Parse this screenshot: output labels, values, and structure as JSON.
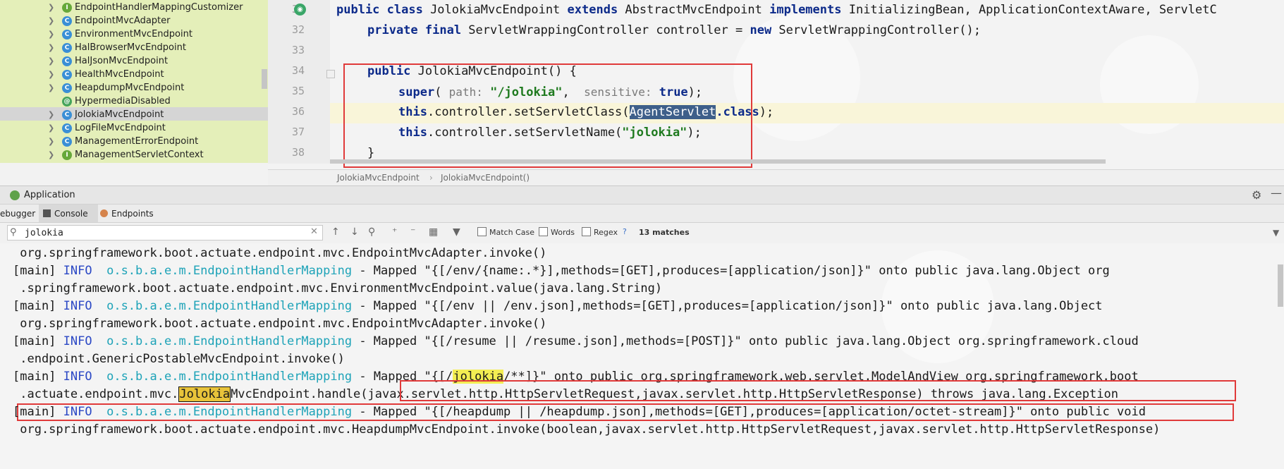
{
  "tree": {
    "items": [
      {
        "label": "EndpointHandlerMappingCustomizer",
        "kind": "interface"
      },
      {
        "label": "EndpointMvcAdapter",
        "kind": "class"
      },
      {
        "label": "EnvironmentMvcEndpoint",
        "kind": "class"
      },
      {
        "label": "HalBrowserMvcEndpoint",
        "kind": "class"
      },
      {
        "label": "HalJsonMvcEndpoint",
        "kind": "class"
      },
      {
        "label": "HealthMvcEndpoint",
        "kind": "class"
      },
      {
        "label": "HeapdumpMvcEndpoint",
        "kind": "class"
      },
      {
        "label": "HypermediaDisabled",
        "kind": "annotation"
      },
      {
        "label": "JolokiaMvcEndpoint",
        "kind": "class",
        "selected": true
      },
      {
        "label": "LogFileMvcEndpoint",
        "kind": "class"
      },
      {
        "label": "ManagementErrorEndpoint",
        "kind": "class"
      },
      {
        "label": "ManagementServletContext",
        "kind": "interface"
      }
    ]
  },
  "editor": {
    "line_numbers": [
      "31",
      "32",
      "33",
      "34",
      "35",
      "36",
      "37",
      "38"
    ],
    "lines": {
      "l31": {
        "kw1": "public class",
        "t1": " JolokiaMvcEndpoint ",
        "kw2": "extends",
        "t2": " AbstractMvcEndpoint ",
        "kw3": "implements",
        "t3": " InitializingBean, ApplicationContextAware, ServletC"
      },
      "l32": {
        "kw1": "private final",
        "t1": " ServletWrappingController controller = ",
        "kw2": "new",
        "t2": " ServletWrappingController();"
      },
      "l34": {
        "kw1": "public",
        "t1": " JolokiaMvcEndpoint() {"
      },
      "l35": {
        "kw1": "super",
        "t1": "( ",
        "hint1": "path:",
        "str1": " \"/jolokia\"",
        "t2": ",  ",
        "hint2": "sensitive:",
        "kw2": " true",
        "t3": ");"
      },
      "l36": {
        "kw1": "this",
        "t1": ".controller.setServletClass(",
        "sel": "AgentServlet",
        "kw2": ".class",
        "t2": ");"
      },
      "l37": {
        "kw1": "this",
        "t1": ".controller.setServletName(",
        "str1": "\"jolokia\"",
        "t2": ");"
      },
      "l38": {
        "t1": "}"
      }
    },
    "breadcrumb": [
      "JolokiaMvcEndpoint",
      "JolokiaMvcEndpoint()"
    ]
  },
  "run": {
    "title": "Application",
    "tabs": [
      "ebugger",
      "Console",
      "Endpoints"
    ]
  },
  "search": {
    "value": "jolokia",
    "options": [
      "Match Case",
      "Words",
      "Regex"
    ],
    "help": "?",
    "matches": "13 matches"
  },
  "console": {
    "prefix": "[main] ",
    "level": "INFO",
    "logger": "o.s.b.a.e.m.EndpointHandlerMapping",
    "lines": [
      {
        "text": " org.springframework.boot.actuate.endpoint.mvc.EndpointMvcAdapter.invoke()"
      },
      {
        "msg": " - Mapped \"{[/env/{name:.*}],methods=[GET],produces=[application/json]}\" onto public java.lang.Object org"
      },
      {
        "text": " .springframework.boot.actuate.endpoint.mvc.EnvironmentMvcEndpoint.value(java.lang.String)"
      },
      {
        "msg": " - Mapped \"{[/env || /env.json],methods=[GET],produces=[application/json]}\" onto public java.lang.Object"
      },
      {
        "text": " org.springframework.boot.actuate.endpoint.mvc.EndpointMvcAdapter.invoke()"
      },
      {
        "msg": " - Mapped \"{[/resume || /resume.json],methods=[POST]}\" onto public java.lang.Object org.springframework.cloud"
      },
      {
        "text": " .endpoint.GenericPostableMvcEndpoint.invoke()"
      },
      {
        "msg_a": " - ",
        "msg_b": "Mapped \"{[/",
        "match": "jolokia",
        "msg_c": "/**]}\" onto public org.springframework.web.servlet.ModelAndView org.springframework.boot"
      },
      {
        "text_a": " .actuate.endpoint.mvc.",
        "match": "Jolokia",
        "text_b": "MvcEndpoint.handle(javax.servlet.http.HttpServletRequest,javax.servlet.http.HttpServletResponse) throws java.lang.Exception"
      },
      {
        "msg": " - Mapped \"{[/heapdump || /heapdump.json],methods=[GET],produces=[application/octet-stream]}\" onto public void"
      },
      {
        "text": " org.springframework.boot.actuate.endpoint.mvc.HeapdumpMvcEndpoint.invoke(boolean,javax.servlet.http.HttpServletRequest,javax.servlet.http.HttpServletResponse)"
      }
    ]
  },
  "colors": {
    "highlight_box": "#e03a3a",
    "match": "#f3ee52",
    "keyword": "#0c2a8a",
    "string": "#1f7a1f",
    "logger": "#1ea3b8"
  }
}
